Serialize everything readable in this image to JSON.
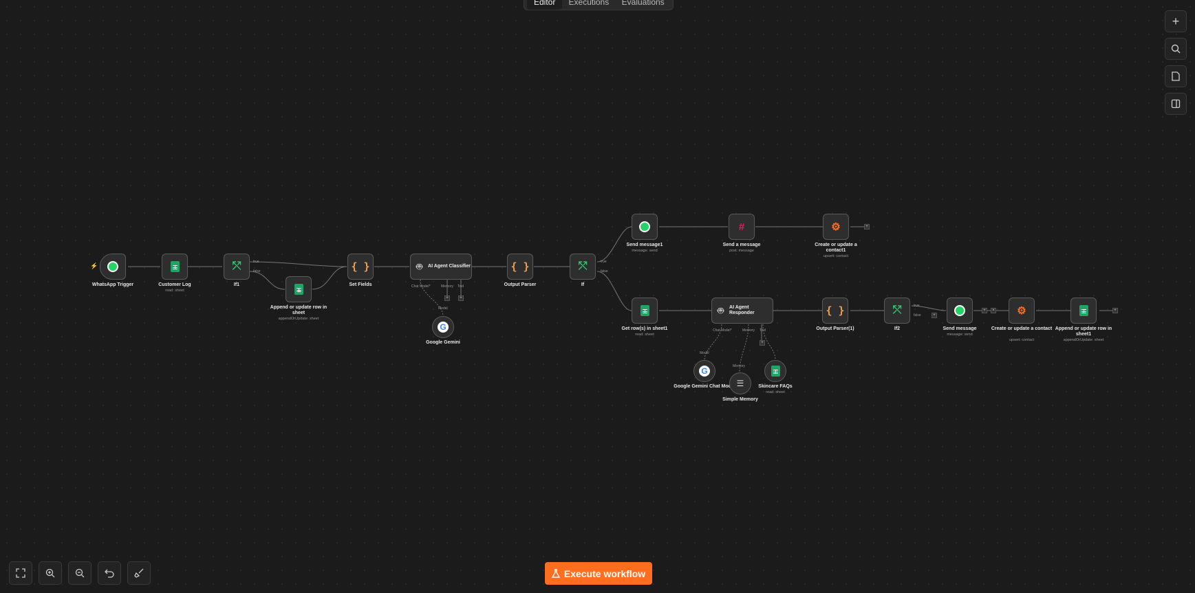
{
  "tabs": [
    "Editor",
    "Executions",
    "Evaluations"
  ],
  "colors": {
    "accent": "#ff6d1f",
    "sheets": "#1fa463",
    "whatsapp": "#25d366"
  },
  "execute_label": "Execute workflow",
  "nodes": {
    "whatsapp_trigger": {
      "label": "WhatsApp Trigger"
    },
    "customer_log": {
      "label": "Customer Log",
      "sub": "read: sheet"
    },
    "if1": {
      "label": "If1",
      "true": "true",
      "false": "false"
    },
    "append_row": {
      "label": "Append or update row in sheet",
      "sub": "appendOrUpdate: sheet"
    },
    "set_fields": {
      "label": "Set Fields"
    },
    "agent_classifier": {
      "title": "AI Agent Classifier",
      "chat_model": "Chat Model*",
      "memory": "Memory",
      "tool": "Tool"
    },
    "google_gemini": {
      "label": "Google Gemini",
      "conn": "Model"
    },
    "output_parser": {
      "label": "Output Parser"
    },
    "if": {
      "label": "If",
      "true": "true",
      "false": "false"
    },
    "send_message1": {
      "label": "Send message1",
      "sub": "message: send"
    },
    "slack_message": {
      "label": "Send a message",
      "sub": "post: message"
    },
    "hubspot_contact1": {
      "label": "Create or update a contact1",
      "sub": "upsert: contact"
    },
    "get_rows": {
      "label": "Get row(s) in sheet1",
      "sub": "read: sheet"
    },
    "agent_responder": {
      "title": "AI Agent Responder",
      "chat_model": "Chat Model*",
      "memory": "Memory",
      "tool": "Tool"
    },
    "gemini_chat": {
      "label": "Google Gemini Chat Model",
      "conn": "Model"
    },
    "simple_memory": {
      "label": "Simple Memory",
      "conn": "Memory"
    },
    "skincare_faqs": {
      "label": "Skincare FAQs",
      "sub": "read: sheet"
    },
    "output_parser1": {
      "label": "Output Parser(1)"
    },
    "if2": {
      "label": "If2",
      "true": "true",
      "false": "false"
    },
    "send_message": {
      "label": "Send message",
      "sub": "message: send"
    },
    "hubspot_contact": {
      "label": "Create or update a contact",
      "sub": "upsert: contact"
    },
    "append_row1": {
      "label": "Append or update row in sheet1",
      "sub": "appendOrUpdate: sheet"
    }
  }
}
